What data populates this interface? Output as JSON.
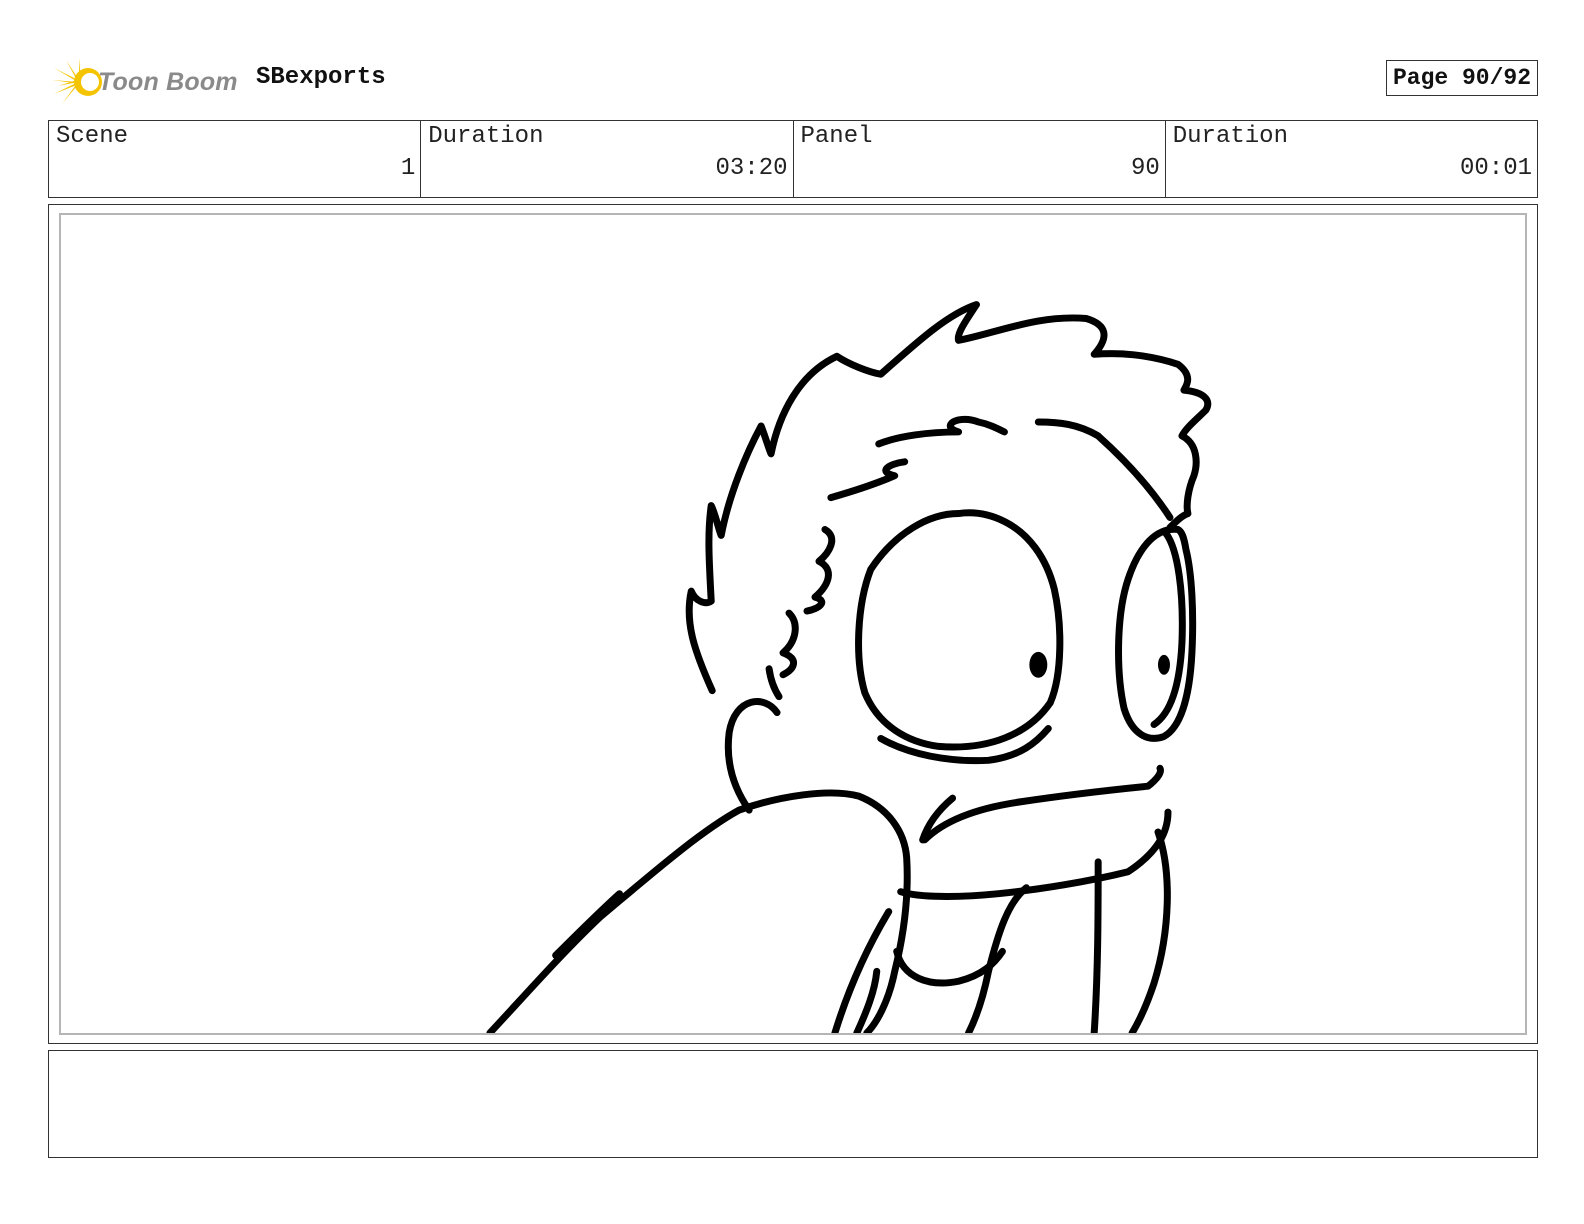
{
  "header": {
    "logo_text": "Toon Boom",
    "project_name": "SBexports",
    "page_label": "Page 90/92"
  },
  "info": {
    "scene_label": "Scene",
    "scene_value": "1",
    "scene_duration_label": "Duration",
    "scene_duration_value": "03:20",
    "panel_label": "Panel",
    "panel_value": "90",
    "panel_duration_label": "Duration",
    "panel_duration_value": "00:01"
  },
  "colors": {
    "logo_yellow": "#f5c400",
    "logo_text_gray": "#8a8a8a",
    "border": "#333333",
    "panel_inner_border": "#b5b5b5",
    "sketch_stroke": "#000000"
  },
  "icons": {
    "logo": "toon-boom-starburst-icon"
  }
}
